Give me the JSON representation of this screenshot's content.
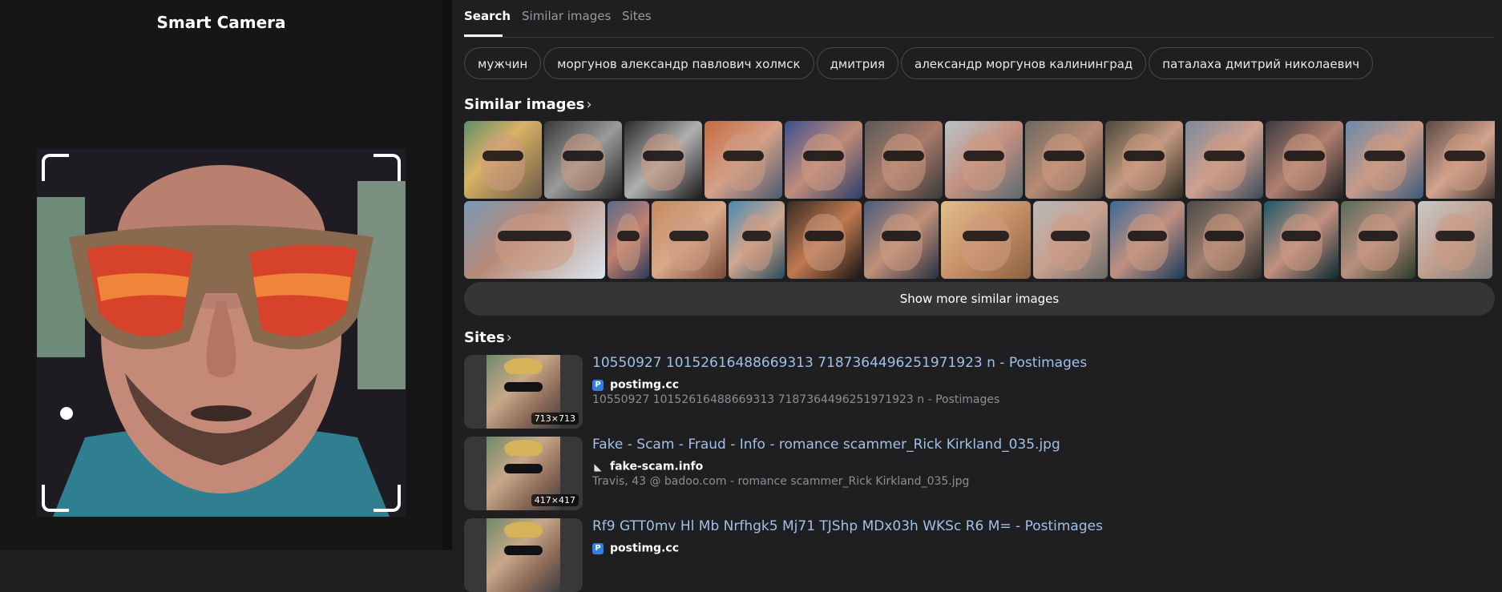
{
  "left_panel": {
    "title": "Smart Camera"
  },
  "tabs": [
    "Search",
    "Similar images",
    "Sites"
  ],
  "tags": [
    "мужчин",
    "моргунов александр павлович холмск",
    "дмитрия",
    "александр моргунов калининград",
    "паталаха дмитрий николаевич"
  ],
  "similar_images": {
    "title": "Similar images",
    "show_more": "Show more similar images"
  },
  "sites": {
    "title": "Sites",
    "results": [
      {
        "title": "10550927 10152616488669313 7187364496251971923 n - Postimages",
        "domain": "postimg.cc",
        "description": "10550927 10152616488669313 7187364496251971923 n - Postimages",
        "size": "713×713",
        "favicon": "postimg-p-icon"
      },
      {
        "title": "Fake - Scam - Fraud - Info - romance scammer_Rick Kirkland_035.jpg",
        "domain": "fake-scam.info",
        "description": "Travis, 43 @ badoo.com - romance scammer_Rick Kirkland_035.jpg",
        "size": "417×417",
        "favicon": "fake-scam-icon"
      },
      {
        "title": "Rf9 GTT0mv Hl Mb Nrfhgk5 Mj71 TJShp MDx03h WKSc R6 M= - Postimages",
        "domain": "postimg.cc",
        "description": "",
        "size": "",
        "favicon": "postimg-p-icon"
      }
    ]
  },
  "colors": {
    "background": "#1f1f21",
    "left_panel": "#161617",
    "link": "#9fc1e8",
    "muted": "#8e8e92"
  }
}
